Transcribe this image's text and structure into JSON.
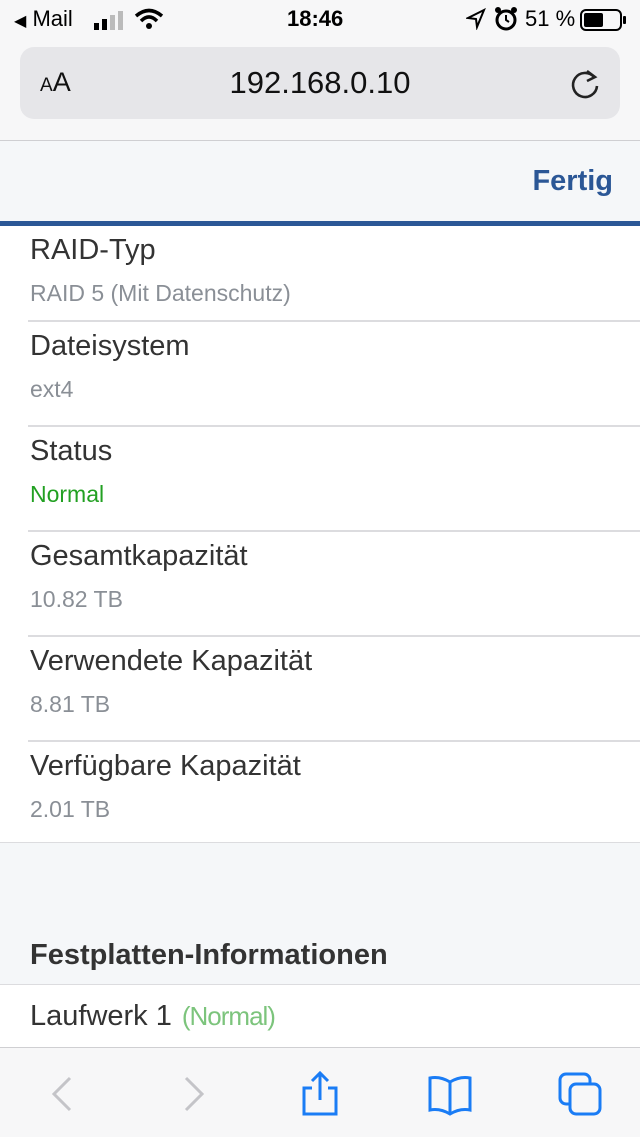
{
  "status_bar": {
    "back_app": "Mail",
    "time": "18:46",
    "battery": "51 %"
  },
  "browser": {
    "text_size_label_small": "A",
    "text_size_label_large": "A",
    "url": "192.168.0.10"
  },
  "header": {
    "done_label": "Fertig"
  },
  "volume_info": [
    {
      "label": "RAID-Typ",
      "value": "RAID 5 (Mit Datenschutz)"
    },
    {
      "label": "Dateisystem",
      "value": "ext4"
    },
    {
      "label": "Status",
      "value": "Normal"
    },
    {
      "label": "Gesamtkapazität",
      "value": "10.82 TB"
    },
    {
      "label": "Verwendete Kapazität",
      "value": "8.81 TB"
    },
    {
      "label": "Verfügbare Kapazität",
      "value": "2.01 TB"
    }
  ],
  "disk_section": {
    "title": "Festplatten-Informationen",
    "drives": [
      {
        "name": "Laufwerk 1",
        "status": "(Normal)"
      }
    ]
  },
  "colors": {
    "accent": "#2b5796",
    "status_ok": "#22a022",
    "ios_blue": "#1a7cf5"
  },
  "icons": {
    "back": "chevron-left-icon",
    "forward": "chevron-right-icon",
    "share": "share-icon",
    "bookmarks": "book-icon",
    "tabs": "tabs-icon",
    "reload": "reload-icon"
  }
}
